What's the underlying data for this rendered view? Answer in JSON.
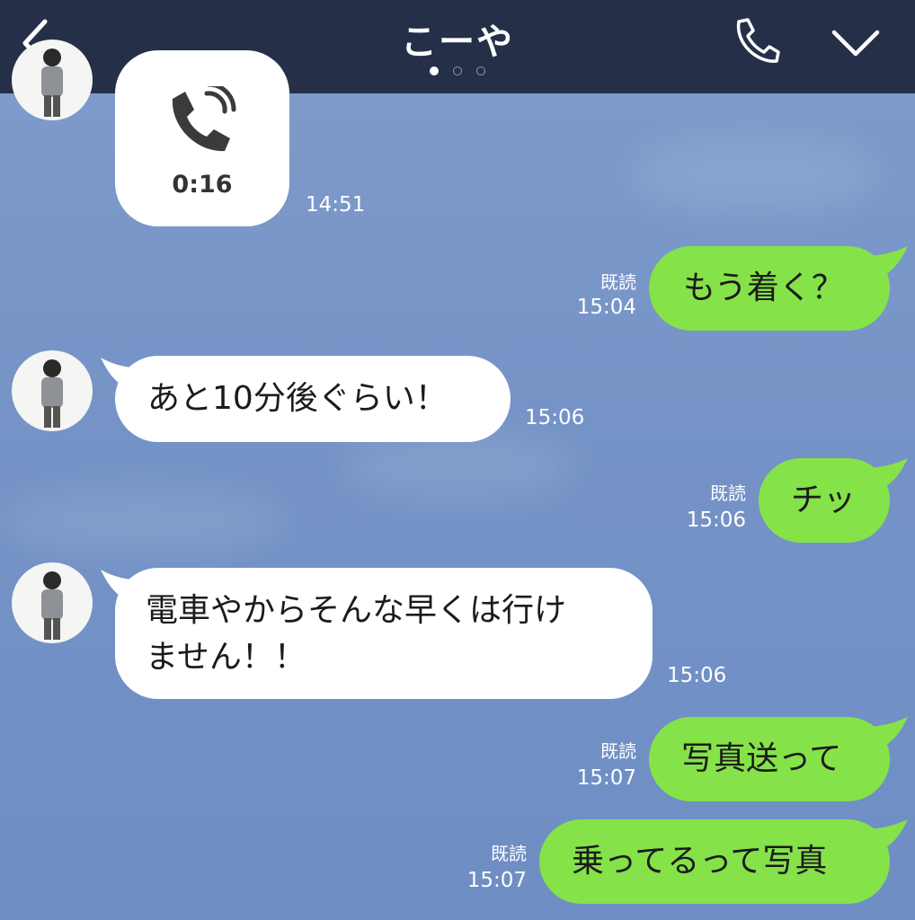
{
  "header": {
    "title": "こーや",
    "back_icon": "chevron-left-icon",
    "call_icon": "phone-icon",
    "menu_icon": "chevron-down-icon",
    "page_dots": 3,
    "active_dot": 1
  },
  "colors": {
    "header_bg": "#253048",
    "chat_bg": "#7593c6",
    "sent_bubble": "#85e249",
    "received_bubble": "#ffffff"
  },
  "messages": [
    {
      "id": 0,
      "side": "received",
      "kind": "call",
      "duration": "0:16",
      "time": "14:51",
      "icon": "phone-call-icon"
    },
    {
      "id": 1,
      "side": "sent",
      "text": "もう着く？",
      "read": "既読",
      "time": "15:04"
    },
    {
      "id": 2,
      "side": "received",
      "text": "あと10分後ぐらい！",
      "time": "15:06"
    },
    {
      "id": 3,
      "side": "sent",
      "text": "チッ",
      "read": "既読",
      "time": "15:06"
    },
    {
      "id": 4,
      "side": "received",
      "lines": [
        "電車やからそんな早くは行け",
        "ません！！"
      ],
      "time": "15:06"
    },
    {
      "id": 5,
      "side": "sent",
      "text": "写真送って",
      "read": "既読",
      "time": "15:07"
    },
    {
      "id": 6,
      "side": "sent",
      "text": "乗ってるって写真",
      "read": "既読",
      "time": "15:07"
    }
  ]
}
